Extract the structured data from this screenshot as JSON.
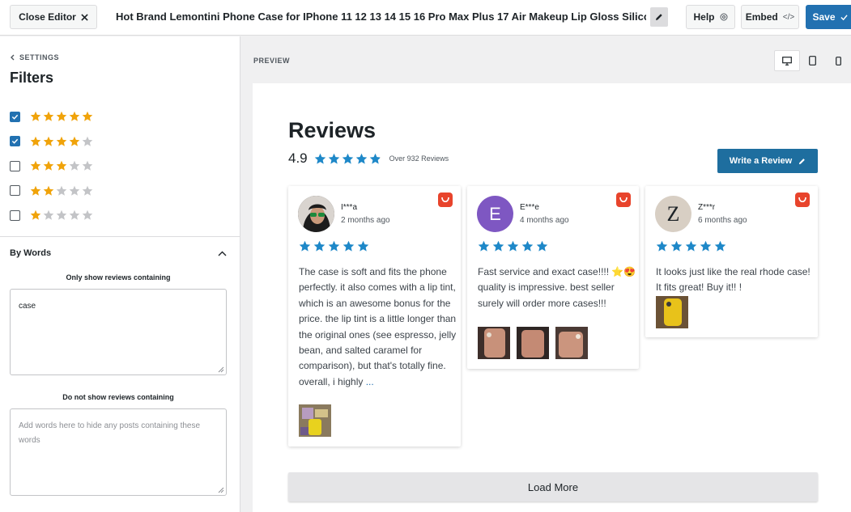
{
  "topbar": {
    "close_label": "Close Editor",
    "title": "Hot Brand Lemontini Phone Case for IPhone 11 12 13 14 15 16 Pro Max Plus 17 Air Makeup Lip Gloss Silicone",
    "help_label": "Help",
    "embed_label": "Embed",
    "save_label": "Save"
  },
  "sidebar": {
    "back_label": "SETTINGS",
    "title": "Filters",
    "star_filters": [
      {
        "stars": 5,
        "checked": true
      },
      {
        "stars": 4,
        "checked": true
      },
      {
        "stars": 3,
        "checked": false
      },
      {
        "stars": 2,
        "checked": false
      },
      {
        "stars": 1,
        "checked": false
      }
    ],
    "by_words": {
      "label": "By Words",
      "include_label": "Only show reviews containing",
      "include_value": "case",
      "exclude_label": "Do not show reviews containing",
      "exclude_placeholder": "Add words here to hide any posts containing these words"
    }
  },
  "preview": {
    "label": "PREVIEW",
    "heading": "Reviews",
    "rating": "4.9",
    "rating_value": 4.9,
    "review_count": "Over 932 Reviews",
    "write_label": "Write a Review",
    "load_more": "Load More",
    "reviews": [
      {
        "author": "I***a",
        "date": "2 months ago",
        "stars": 5,
        "text": "The case is soft and fits the phone perfectly. it also comes with a lip tint, which is an awesome bonus for the price. the lip tint is a little longer than the original ones (see espresso, jelly bean, and salted caramel for comparison), but that's totally fine. overall, i highly",
        "more": "..."
      },
      {
        "author": "E***e",
        "initial": "E",
        "date": "4 months ago",
        "stars": 5,
        "text": "Fast service and exact case!!!! ⭐😍 quality is impressive. best seller surely will order more cases!!!"
      },
      {
        "author": "Z***r",
        "initial": "Z",
        "date": "6 months ago",
        "stars": 5,
        "text": "It looks just like the real rhode case! It fits great! Buy it!! !"
      }
    ]
  },
  "colors": {
    "accent": "#2271b1",
    "filter_star": "#f0a30a",
    "review_star": "#1e88c8",
    "empty_star": "#c3c4c7",
    "write_button": "#1e6e9f",
    "aliexpress": "#e8442c"
  },
  "icons": {
    "close": "close-icon",
    "edit": "pencil-icon",
    "help": "help-icon",
    "embed": "code-icon",
    "save": "check-icon",
    "back": "chevron-left-icon",
    "collapse": "chevron-up-icon",
    "desktop": "desktop-icon",
    "tablet": "tablet-icon",
    "mobile": "mobile-icon",
    "source": "aliexpress-icon"
  }
}
